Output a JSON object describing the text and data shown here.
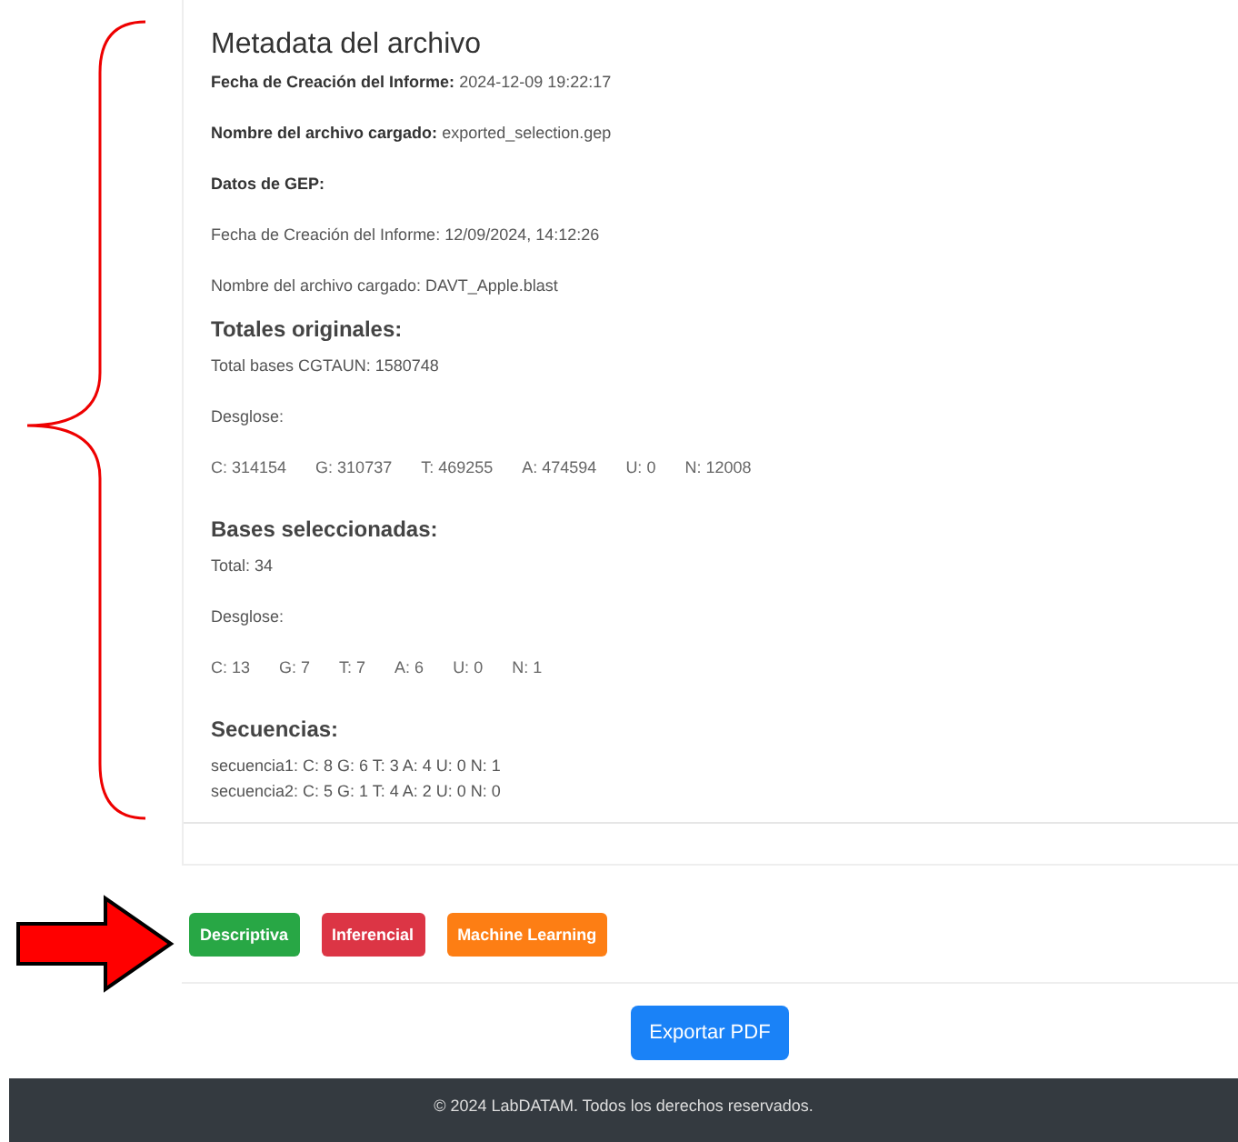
{
  "metadata": {
    "title": "Metadata del archivo",
    "fields": [
      {
        "label": "Fecha de Creación del Informe:",
        "value": "2024-12-09 19:22:17"
      },
      {
        "label": "Nombre del archivo cargado:",
        "value": "exported_selection.gep"
      }
    ],
    "gep": {
      "heading": "Datos de GEP:",
      "lines": [
        "Fecha de Creación del Informe: 12/09/2024, 14:12:26",
        "Nombre del archivo cargado: DAVT_Apple.blast"
      ]
    },
    "sections": [
      {
        "heading": "Totales originales:",
        "total": "Total bases CGTAUN: 1580748",
        "breakdown_label": "Desglose:",
        "counts": [
          "C: 314154",
          "G: 310737",
          "T: 469255",
          "A: 474594",
          "U: 0",
          "N: 12008"
        ]
      },
      {
        "heading": "Bases seleccionadas:",
        "total": "Total: 34",
        "breakdown_label": "Desglose:",
        "counts": [
          "C: 13",
          "G: 7",
          "T: 7",
          "A: 6",
          "U: 0",
          "N: 1"
        ]
      }
    ],
    "sequences": {
      "heading": "Secuencias:",
      "lines": [
        "secuencia1: C: 8 G: 6 T: 3 A: 4 U: 0 N: 1",
        "secuencia2: C: 5 G: 1 T: 4 A: 2 U: 0 N: 0"
      ]
    }
  },
  "analysis_buttons": [
    {
      "label": "Descriptiva",
      "color": "#28a745"
    },
    {
      "label": "Inferencial",
      "color": "#dc3545"
    },
    {
      "label": "Machine Learning",
      "color": "#fd7e14"
    }
  ],
  "export_button": "Exportar PDF",
  "footer": "© 2024 LabDATAM. Todos los derechos reservados."
}
